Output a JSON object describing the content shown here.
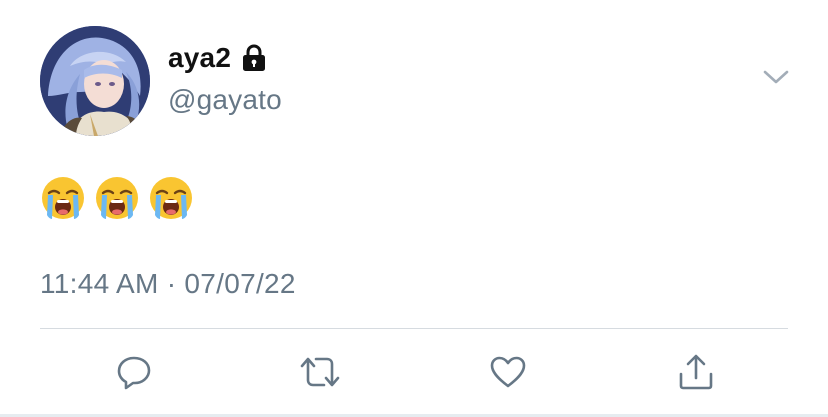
{
  "tweet": {
    "author": {
      "display_name": "aya2",
      "handle": "@gayato",
      "protected_icon": "lock-icon",
      "avatar_icon": "avatar-illustration"
    },
    "text_emojis": [
      "😭",
      "😭",
      "😭"
    ],
    "timestamp": "11:44 AM · 07/07/22",
    "menu_icon": "chevron-down-icon",
    "actions": {
      "reply_icon": "reply-icon",
      "retweet_icon": "retweet-icon",
      "like_icon": "heart-icon",
      "share_icon": "share-icon"
    }
  },
  "colors": {
    "text_primary": "#111111",
    "text_secondary": "#667786",
    "divider": "#d6dbe0",
    "action_icon": "#667786"
  }
}
